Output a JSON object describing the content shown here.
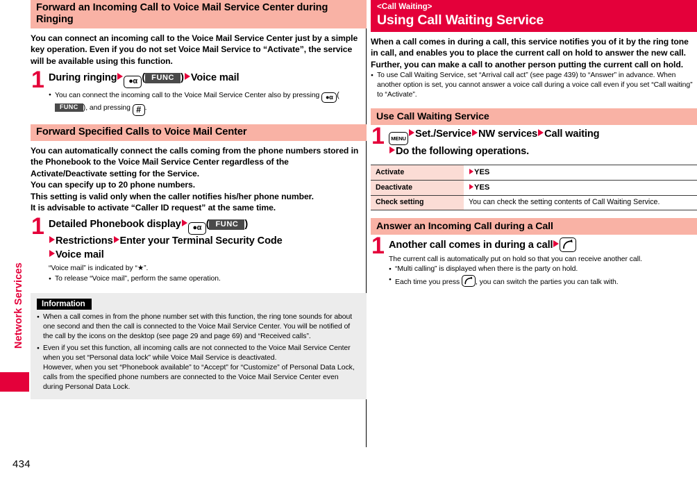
{
  "page": {
    "number": "434",
    "side_label": "Network Services"
  },
  "left_column": {
    "section1": {
      "heading": "Forward an Incoming Call to Voice Mail Service Center during Ringing",
      "lead": "You can connect an incoming call to the Voice Mail Service Center just by a simple key operation. Even if you do not set Voice Mail Service to “Activate”, the service will be available using this function.",
      "step": {
        "number": "1",
        "title_part1": "During ringing",
        "key_icon": "i-alpha-key-icon",
        "key_label": "FUNC",
        "title_part2": "Voice mail",
        "bullet": {
          "text_before": "You can connect the incoming call to the Voice Mail Service Center also by pressing",
          "key_label": "FUNC",
          "text_middle": ", and pressing",
          "key_hash": "#",
          "text_after": "."
        }
      }
    },
    "section2": {
      "heading": "Forward Specified Calls to Voice Mail Center",
      "lead": "You can automatically connect the calls coming from the phone numbers stored in the Phonebook to the Voice Mail Service Center regardless of the Activate/Deactivate setting for the Service.\nYou can specify up to 20 phone numbers.\nThis setting is valid only when the caller notifies his/her phone number.\nIt is advisable to activate “Caller ID request” at the same time.",
      "step": {
        "number": "1",
        "line1_part1": "Detailed Phonebook display",
        "key_label": "FUNC",
        "line2_part1": "Restrictions",
        "line2_part2": "Enter your Terminal Security Code",
        "line3": "Voice mail",
        "note": "“Voice mail” is indicated by “★”.",
        "bullet": "To release “Voice mail”, perform the same operation."
      }
    },
    "information": {
      "heading": "Information",
      "bullets": [
        "When a call comes in from the phone number set with this function, the ring tone sounds for about one second and then the call is connected to the Voice Mail Service Center. You will be notified of the call by the icons on the desktop (see page 29 and page 69) and “Received calls”.",
        "Even if you set this function, all incoming calls are not connected to the Voice Mail Service Center when you set “Personal data lock” while Voice Mail Service is deactivated."
      ],
      "continuation": "However, when you set “Phonebook available” to “Accept” for “Customize” of Personal Data Lock, calls from the specified phone numbers are connected to the Voice Mail Service Center even during Personal Data Lock."
    }
  },
  "right_column": {
    "header": {
      "eyebrow": "<Call Waiting>",
      "title": "Using Call Waiting Service"
    },
    "lead": "When a call comes in during a call, this service notifies you of it by the ring tone in call, and enables you to place the current call on hold to answer the new call.\nFurther, you can make a call to another person putting the current call on hold.",
    "lead_bullet": "To use Call Waiting Service, set “Arrival call act” (see page 439) to “Answer” in advance. When another option is set, you cannot answer a voice call during a voice call even if you set “Call waiting” to “Activate”.",
    "section1": {
      "heading": "Use Call Waiting Service",
      "step": {
        "number": "1",
        "key_icon": "menu-key-icon",
        "line1_part1": "Set./Service",
        "line1_part2": "NW services",
        "line1_part3": "Call waiting",
        "line2": "Do the following operations."
      },
      "table": {
        "rows": [
          {
            "key": "Activate",
            "value": "YES",
            "value_has_arrow": true
          },
          {
            "key": "Deactivate",
            "value": "YES",
            "value_has_arrow": true
          },
          {
            "key": "Check setting",
            "value": "You can check the setting contents of Call Waiting Service.",
            "value_has_arrow": false
          }
        ]
      }
    },
    "section2": {
      "heading": "Answer an Incoming Call during a Call",
      "step": {
        "number": "1",
        "title": "Another call comes in during a call",
        "key_icon": "call-key-icon",
        "note": "The current call is automatically put on hold so that you can receive another call.",
        "bullets": [
          "“Multi calling” is displayed when there is the party on hold.",
          "Each time you press"
        ],
        "bullet2_after": ", you can switch the parties you can talk with."
      }
    }
  },
  "colors": {
    "accent_red": "#e4003a",
    "band_pink": "#f9b2a5",
    "table_key_pink": "#fbdcd5",
    "info_gray": "#ececec",
    "func_gray": "#4a4a4a"
  }
}
